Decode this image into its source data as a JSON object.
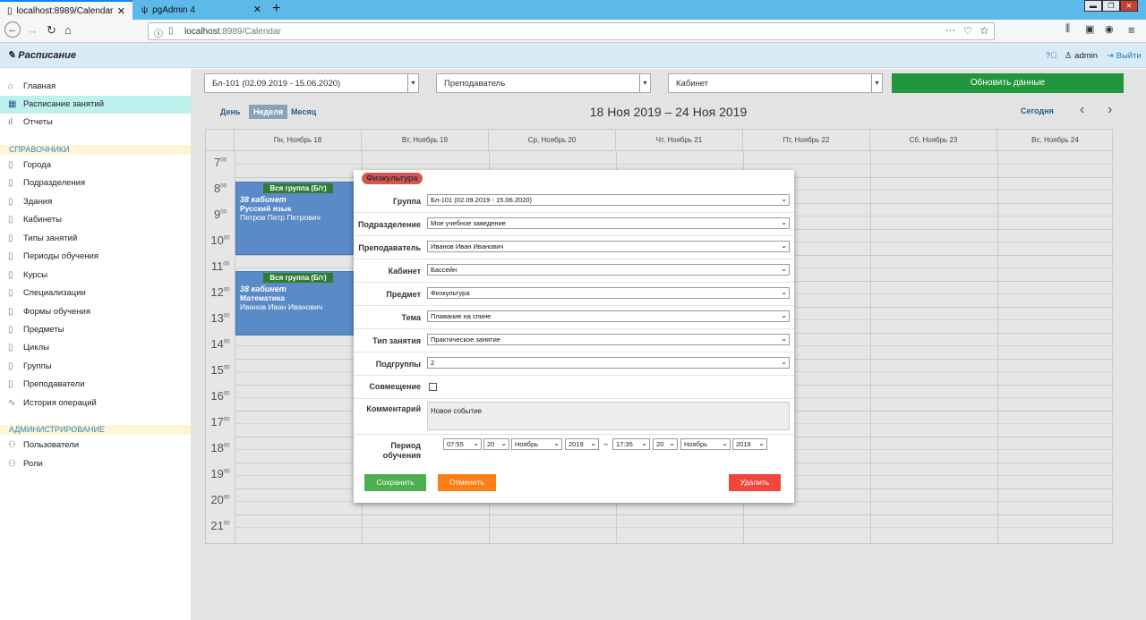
{
  "browser": {
    "tabs": [
      {
        "title": "localhost:8989/Calendar"
      },
      {
        "title": "pgAdmin 4"
      }
    ],
    "url_host": "localhost",
    "url_rest": ":8989/Calendar"
  },
  "app": {
    "brand": "Расписание",
    "user": "admin",
    "logout": "Выйти"
  },
  "sidebar": {
    "main_items": [
      {
        "label": "Главная",
        "icon": "home-icon"
      },
      {
        "label": "Расписание занятий",
        "icon": "calendar-icon"
      },
      {
        "label": "Отчеты",
        "icon": "bar-chart-icon"
      }
    ],
    "section1": "СПРАВОЧНИКИ",
    "ref_items": [
      {
        "label": "Города"
      },
      {
        "label": "Подразделения"
      },
      {
        "label": "Здания"
      },
      {
        "label": "Кабинеты"
      },
      {
        "label": "Типы занятий"
      },
      {
        "label": "Периоды обучения"
      },
      {
        "label": "Курсы"
      },
      {
        "label": "Специализации"
      },
      {
        "label": "Формы обучения"
      },
      {
        "label": "Предметы"
      },
      {
        "label": "Циклы"
      },
      {
        "label": "Группы"
      },
      {
        "label": "Преподаватели"
      },
      {
        "label": "История операций"
      }
    ],
    "section2": "АДМИНИСТРИРОВАНИЕ",
    "admin_items": [
      {
        "label": "Пользователи"
      },
      {
        "label": "Роли"
      }
    ]
  },
  "toolbar": {
    "group": "Бл-101 (02.09.2019 - 15.06.2020)",
    "teacher": "Преподаватель",
    "room": "Кабинет",
    "refresh": "Обновить данные"
  },
  "calendar": {
    "views": {
      "day": "День",
      "week": "Неделя",
      "month": "Месяц"
    },
    "range": "18 Ноя 2019 – 24 Ноя 2019",
    "today": "Сегодня",
    "days": [
      "Пн, Ноябрь 18",
      "Вт, Ноябрь 19",
      "Ср, Ноябрь 20",
      "Чт, Ноябрь 21",
      "Пт, Ноябрь 22",
      "Сб, Ноябрь 23",
      "Вс, Ноябрь 24"
    ],
    "hours": [
      "7",
      "8",
      "9",
      "10",
      "11",
      "12",
      "13",
      "14",
      "15",
      "16",
      "17",
      "18",
      "19",
      "20",
      "21"
    ],
    "minutes": "00",
    "events": [
      {
        "group": "Вся группа (Б/т)",
        "room": "38 кабинет",
        "subject": "Русский язык",
        "teacher": "Петров Петр Петрович"
      },
      {
        "group": "Вся группа (Б/т)",
        "room": "38 кабинет",
        "subject": "Математика",
        "teacher": "Иванов Иван Иванович"
      }
    ]
  },
  "modal": {
    "title": "Физкультура",
    "fields": {
      "group": {
        "label": "Группа",
        "value": "Бл-101 (02.09.2019 - 15.06.2020)"
      },
      "division": {
        "label": "Подразделение",
        "value": "Мое учебное заведение"
      },
      "teacher": {
        "label": "Преподаватель",
        "value": "Иванов Иван Иванович"
      },
      "room": {
        "label": "Кабинет",
        "value": "Бассейн"
      },
      "subject": {
        "label": "Предмет",
        "value": "Физкультура"
      },
      "topic": {
        "label": "Тема",
        "value": "Плавание на спине"
      },
      "lesson_type": {
        "label": "Тип занятия",
        "value": "Практическое занятие"
      },
      "subgroups": {
        "label": "Подгруппы",
        "value": "2"
      }
    },
    "combine_label": "Совмещение",
    "comment_label": "Комментарий",
    "comment_value": "Новое событие",
    "period_label1": "Период",
    "period_label2": "обучения",
    "start": {
      "time": "07:55",
      "day": "20",
      "month": "Ноябрь",
      "year": "2019"
    },
    "dash": "–",
    "end": {
      "time": "17:35",
      "day": "20",
      "month": "Ноябрь",
      "year": "2019"
    },
    "save": "Сохранить",
    "cancel": "Отменить",
    "delete": "Удалить"
  },
  "colors": {
    "accent_green": "#21963c",
    "event_blue": "#5a8ac8",
    "danger": "#f0463c",
    "warning": "#fd7e14"
  }
}
